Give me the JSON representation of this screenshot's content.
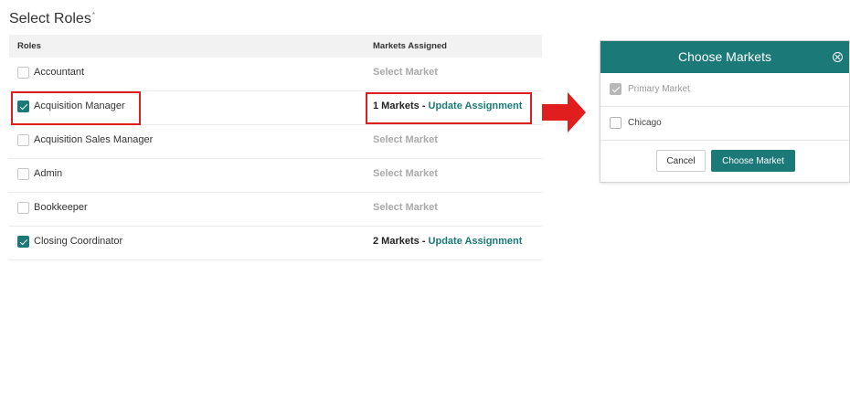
{
  "page": {
    "title": "Select Roles",
    "required_marker": "*"
  },
  "table": {
    "headers": {
      "roles": "Roles",
      "markets": "Markets Assigned"
    },
    "rows": [
      {
        "role": "Accountant",
        "checked": false,
        "market_text": "Select Market"
      },
      {
        "role": "Acquisition Manager",
        "checked": true,
        "market_count": "1 Markets",
        "separator": " - ",
        "link": "Update Assignment"
      },
      {
        "role": "Acquisition Sales Manager",
        "checked": false,
        "market_text": "Select Market"
      },
      {
        "role": "Admin",
        "checked": false,
        "market_text": "Select Market"
      },
      {
        "role": "Bookkeeper",
        "checked": false,
        "market_text": "Select Market"
      },
      {
        "role": "Closing Coordinator",
        "checked": true,
        "market_count": "2 Markets",
        "separator": " - ",
        "link": "Update Assignment"
      }
    ]
  },
  "modal": {
    "title": "Choose Markets",
    "markets": [
      {
        "label": "Primary Market",
        "checked": true,
        "disabled": true
      },
      {
        "label": "Chicago",
        "checked": false,
        "disabled": false
      }
    ],
    "cancel_label": "Cancel",
    "confirm_label": "Choose Market"
  },
  "colors": {
    "accent": "#1b7a78",
    "highlight": "#e01e1e",
    "arrow": "#e01e1e"
  },
  "icons": {
    "close": "close-circle-icon",
    "arrow": "arrow-right-icon",
    "checkbox": "checkbox-icon"
  }
}
